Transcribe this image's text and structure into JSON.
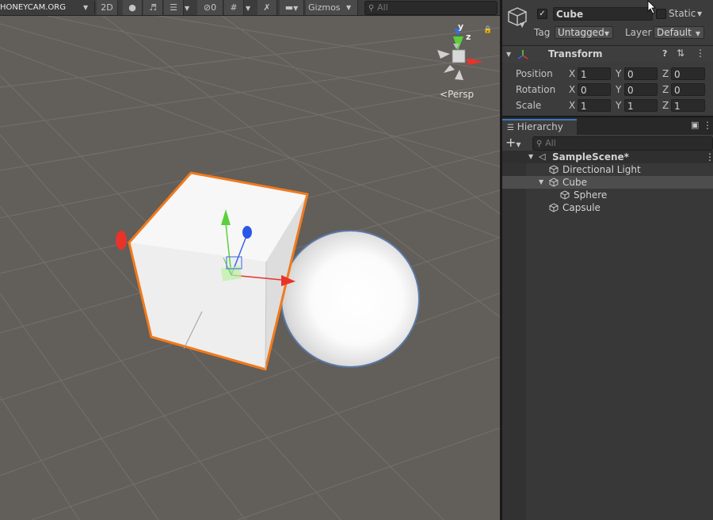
{
  "watermark": "HONEYCAM.ORG",
  "scene_toolbar": {
    "mode_2d": "2D",
    "hidden_count": "0",
    "gizmos_label": "Gizmos",
    "search_placeholder": "All",
    "persp_label": "Persp",
    "axes": {
      "y": "y",
      "z": "z"
    }
  },
  "inspector": {
    "object_name": "Cube",
    "active_checked": true,
    "static_label": "Static",
    "tag_label": "Tag",
    "tag_value": "Untagged",
    "layer_label": "Layer",
    "layer_value": "Default",
    "component_title": "Transform",
    "rows": [
      {
        "label": "Position",
        "x": "1",
        "y": "0",
        "z": "0"
      },
      {
        "label": "Rotation",
        "x": "0",
        "y": "0",
        "z": "0"
      },
      {
        "label": "Scale",
        "x": "1",
        "y": "1",
        "z": "1"
      }
    ],
    "axis_labels": {
      "x": "X",
      "y": "Y",
      "z": "Z"
    }
  },
  "hierarchy": {
    "tab_label": "Hierarchy",
    "search_placeholder": "All",
    "scene_name": "SampleScene*",
    "items": [
      {
        "name": "Directional Light"
      },
      {
        "name": "Cube"
      },
      {
        "name": "Sphere"
      },
      {
        "name": "Capsule"
      }
    ]
  },
  "colors": {
    "selection_outline": "#f07a1e",
    "axis_x": "#e8332a",
    "axis_y": "#5ad13a",
    "axis_z": "#2a57e6",
    "scene_bg": "#625e59",
    "panel_bg": "#383838"
  }
}
